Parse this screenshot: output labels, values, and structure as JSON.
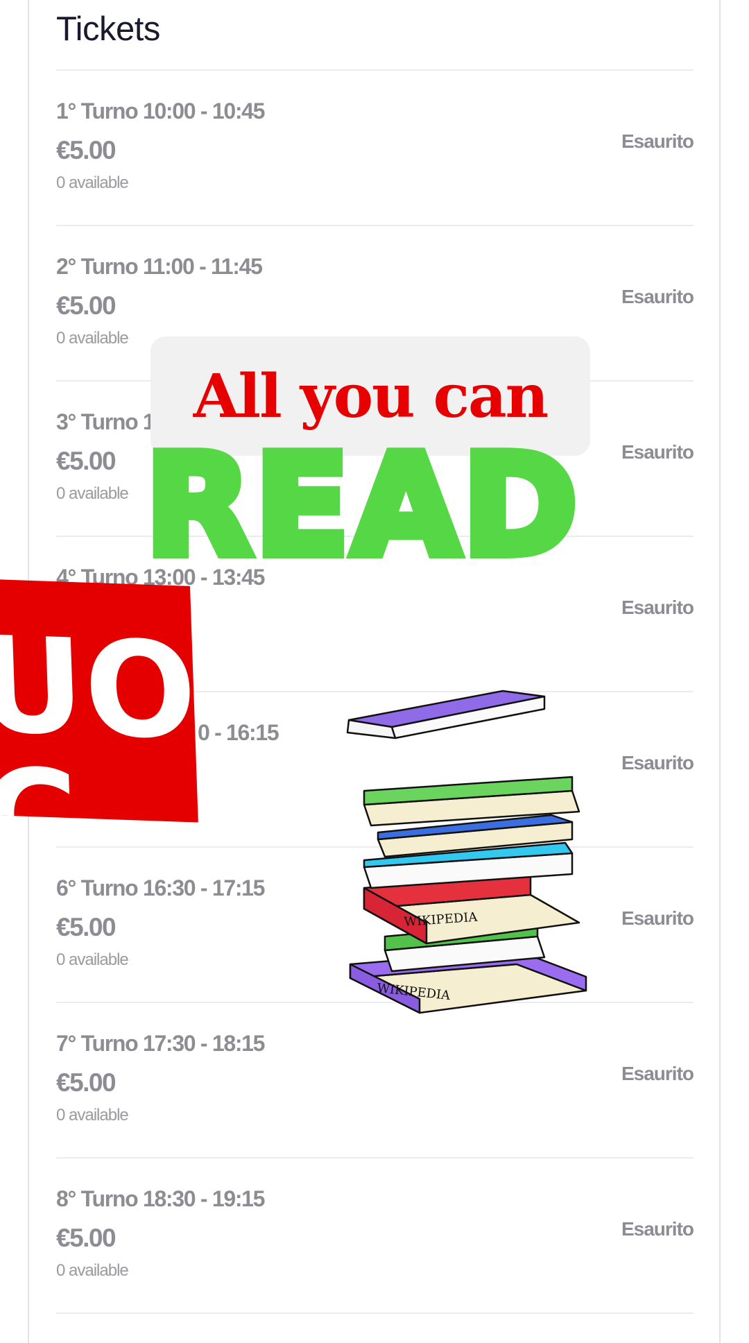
{
  "page": {
    "heading": "Tickets"
  },
  "tickets": [
    {
      "name": "1° Turno 10:00 - 10:45",
      "price": "€5.00",
      "availability": "0 available",
      "status": "Esaurito"
    },
    {
      "name": "2° Turno 11:00 - 11:45",
      "price": "€5.00",
      "availability": "0 available",
      "status": "Esaurito"
    },
    {
      "name": "3° Turno 1",
      "price": "€5.00",
      "availability": "0 available",
      "status": "Esaurito"
    },
    {
      "name": "4° Turno 13:00 - 13:45",
      "price": "",
      "availability": "",
      "status": "Esaurito"
    },
    {
      "name": "0 - 16:15",
      "price": "",
      "availability": "",
      "status": "Esaurito"
    },
    {
      "name": "6° Turno 16:30 - 17:15",
      "price": "€5.00",
      "availability": "0 available",
      "status": "Esaurito"
    },
    {
      "name": "7° Turno 17:30 - 18:15",
      "price": "€5.00",
      "availability": "0 available",
      "status": "Esaurito"
    },
    {
      "name": "8° Turno 18:30 - 19:15",
      "price": "€5.00",
      "availability": "0 available",
      "status": "Esaurito"
    }
  ],
  "stickers": {
    "all_you_can": "All you can",
    "read": "READ",
    "red_sticker_text": "UO C",
    "books_text": "WIKIPEDIA"
  },
  "colors": {
    "sticker_red": "#e60000",
    "sticker_green": "#56d846",
    "muted_text": "#8d8c93"
  }
}
